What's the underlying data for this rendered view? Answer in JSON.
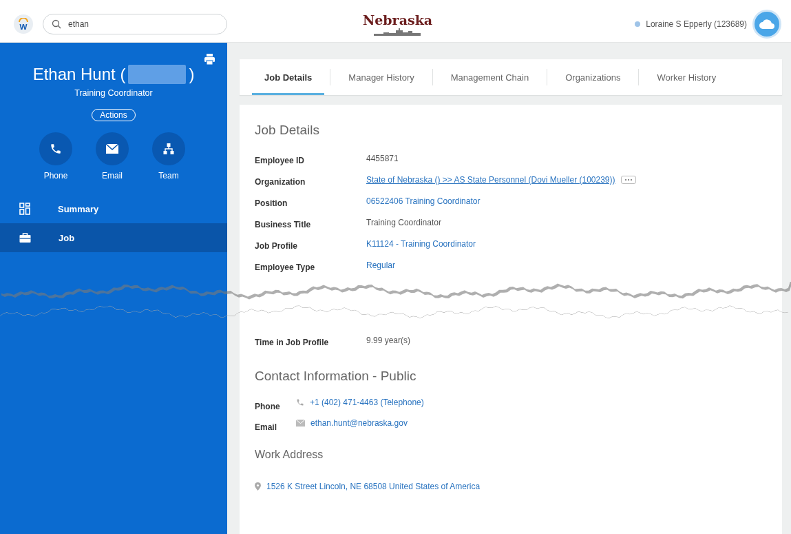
{
  "header": {
    "logo_letter": "w",
    "search": {
      "value": "ethan"
    },
    "brand": "Nebraska",
    "user": "Loraine S Epperly (123689)"
  },
  "profile": {
    "name_start": "Ethan Hunt (",
    "name_end": ")",
    "title": "Training Coordinator",
    "actions": "Actions",
    "quick_actions": [
      {
        "kind": "phone",
        "label": "Phone"
      },
      {
        "kind": "email",
        "label": "Email"
      },
      {
        "kind": "team",
        "label": "Team"
      }
    ]
  },
  "nav": [
    {
      "kind": "summary",
      "label": "Summary",
      "selected": false
    },
    {
      "kind": "job",
      "label": "Job",
      "selected": true
    }
  ],
  "tabs": [
    {
      "label": "Job Details",
      "selected": true
    },
    {
      "label": "Manager History",
      "selected": false
    },
    {
      "label": "Management Chain",
      "selected": false
    },
    {
      "label": "Organizations",
      "selected": false
    },
    {
      "label": "Worker History",
      "selected": false
    }
  ],
  "job_details": {
    "title": "Job Details",
    "fields": [
      {
        "label": "Employee ID",
        "value": "4455871",
        "kind": "text"
      },
      {
        "label": "Organization",
        "value": "State of Nebraska () >> AS State Personnel (Dovi Mueller (100239))",
        "kind": "underlined-link",
        "more": true
      },
      {
        "label": "Position",
        "value": "06522406 Training Coordinator",
        "kind": "link"
      },
      {
        "label": "Business Title",
        "value": "Training Coordinator",
        "kind": "text"
      },
      {
        "label": "Job Profile",
        "value": "K11124 - Training Coordinator",
        "kind": "link"
      },
      {
        "label": "Employee Type",
        "value": "Regular",
        "kind": "link"
      }
    ],
    "lower_fields": [
      {
        "label": "Time in Job Profile",
        "value": "9.99 year(s)",
        "kind": "text"
      }
    ]
  },
  "contact": {
    "title": "Contact Information - Public",
    "items": [
      {
        "kind": "phone",
        "label": "Phone",
        "value": "+1 (402) 471-4463 (Telephone)"
      },
      {
        "kind": "email",
        "label": "Email",
        "value": "ethan.hunt@nebraska.gov"
      }
    ]
  },
  "work_address": {
    "title": "Work Address",
    "address": "1526 K Street Lincoln, NE 68508 United States of America"
  }
}
